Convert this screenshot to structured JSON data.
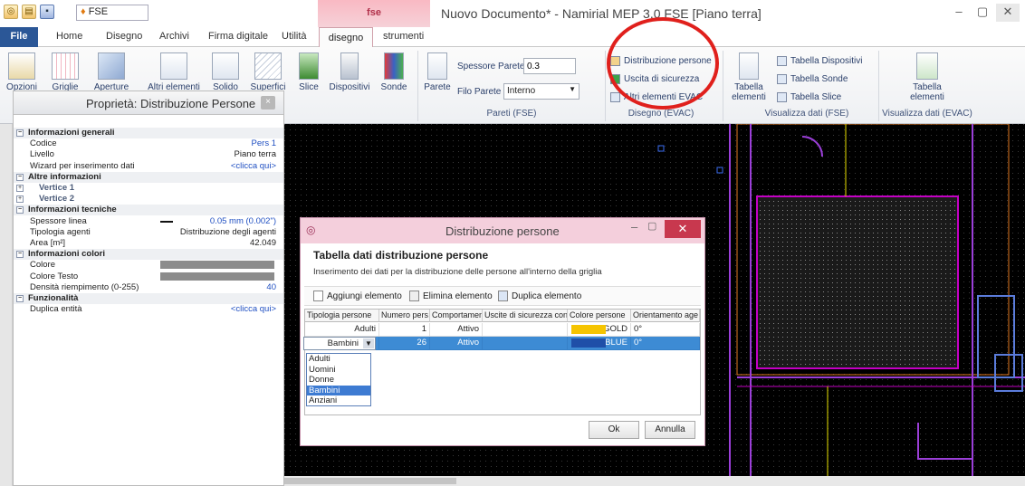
{
  "titlebar": {
    "doc_combo": "FSE",
    "context_tab_group": "fse",
    "window_title": "Nuovo Documento* - Namirial MEP 3.0 FSE [Piano terra]",
    "window_buttons": [
      "–",
      "▢",
      "✕"
    ]
  },
  "tabs": [
    "File",
    "Home",
    "Disegno",
    "Archivi",
    "Firma digitale",
    "Utilità",
    "disegno",
    "strumenti"
  ],
  "ribbon": {
    "buttons": [
      {
        "label": "Opzioni",
        "icon": "options-icon"
      },
      {
        "label": "Griglie",
        "icon": "grid-icon"
      },
      {
        "label": "Aperture",
        "icon": "openings-icon"
      },
      {
        "label": "Altri elementi",
        "icon": "other-elements-icon"
      },
      {
        "label": "Solido",
        "icon": "solid-icon"
      },
      {
        "label": "Superfici",
        "icon": "surfaces-icon"
      },
      {
        "label": "Slice",
        "icon": "slice-icon"
      },
      {
        "label": "Dispositivi",
        "icon": "devices-icon"
      },
      {
        "label": "Sonde",
        "icon": "probes-icon"
      },
      {
        "label": "Parete",
        "icon": "wall-icon"
      }
    ],
    "spessore_label": "Spessore Parete",
    "spessore_value": "0.3",
    "filo_label": "Filo Parete",
    "filo_value": "Interno",
    "group_pareti": "Pareti (FSE)",
    "evac_items": [
      "Distribuzione persone",
      "Uscita di sicurezza",
      "Altri elementi EVAC"
    ],
    "group_disegno_evac": "Disegno (EVAC)",
    "tabella_elementi": "Tabella elementi",
    "vis_items": [
      "Tabella Dispositivi",
      "Tabella Sonde",
      "Tabella Slice"
    ],
    "group_vis_fse": "Visualizza dati (FSE)",
    "tabella_elementi_evac": "Tabella elementi",
    "group_vis_evac": "Visualizza dati (EVAC)"
  },
  "panel": {
    "title": "Proprietà: Distribuzione Persone",
    "rows": [
      {
        "type": "cat",
        "k": "Informazioni generali",
        "exp": "–"
      },
      {
        "type": "row",
        "k": "Codice",
        "v": "Pers 1",
        "link": true
      },
      {
        "type": "row",
        "k": "Livello",
        "v": "Piano terra"
      },
      {
        "type": "row",
        "k": "Wizard per inserimento dati",
        "v": "<clicca qui>",
        "link": true
      },
      {
        "type": "cat",
        "k": "Altre informazioni",
        "exp": "–"
      },
      {
        "type": "sub",
        "k": "Vertice 1",
        "exp": "+"
      },
      {
        "type": "sub",
        "k": "Vertice 2",
        "exp": "+"
      },
      {
        "type": "cat",
        "k": "Informazioni tecniche",
        "exp": "–"
      },
      {
        "type": "row",
        "k": "Spessore linea",
        "v": "0.05 mm (0.002\")",
        "link": true,
        "line": true
      },
      {
        "type": "row",
        "k": "Tipologia agenti",
        "v": "Distribuzione degli agenti"
      },
      {
        "type": "row",
        "k": "Area [m²]",
        "v": "42.049"
      },
      {
        "type": "cat",
        "k": "Informazioni colori",
        "exp": "–"
      },
      {
        "type": "row",
        "k": "Colore",
        "bar": true
      },
      {
        "type": "row",
        "k": "Colore Testo",
        "bar": true
      },
      {
        "type": "row",
        "k": "Densità riempimento (0-255)",
        "v": "40",
        "link": true
      },
      {
        "type": "cat",
        "k": "Funzionalità",
        "exp": "–"
      },
      {
        "type": "row",
        "k": "Duplica entità",
        "v": "<clicca qui>",
        "link": true
      }
    ]
  },
  "dialog": {
    "title": "Distribuzione persone",
    "heading": "Tabella dati distribuzione persone",
    "subtitle": "Inserimento dei dati per la distribuzione delle persone all'interno della griglia",
    "toolbar": [
      "Aggiungi elemento",
      "Elimina elemento",
      "Duplica elemento"
    ],
    "columns": [
      "Tipologia persone",
      "Numero pers",
      "Comportamen",
      "Uscite di sicurezza con",
      "Colore persone",
      "Orientamento age"
    ],
    "rows": [
      {
        "tipo": "Adulti",
        "numero": "1",
        "comp": "Attivo",
        "uscite": "",
        "colore_name": "GOLD",
        "colore_hex": "#f5c400",
        "orient": "0°"
      },
      {
        "tipo": "Bambini",
        "numero": "26",
        "comp": "Attivo",
        "uscite": "",
        "colore_name": "BLUE",
        "colore_hex": "#1f4fa8",
        "orient": "0°"
      }
    ],
    "dropdown_options": [
      "Adulti",
      "Uomini",
      "Donne",
      "Bambini",
      "Anziani"
    ],
    "dropdown_selected": "Bambini",
    "ok": "Ok",
    "cancel": "Annulla"
  },
  "colors": {
    "file_tab": "#2b5797",
    "context_tab": "#f6c0ca",
    "highlight_circle": "#e0201c",
    "selection": "#3d8bd4"
  }
}
